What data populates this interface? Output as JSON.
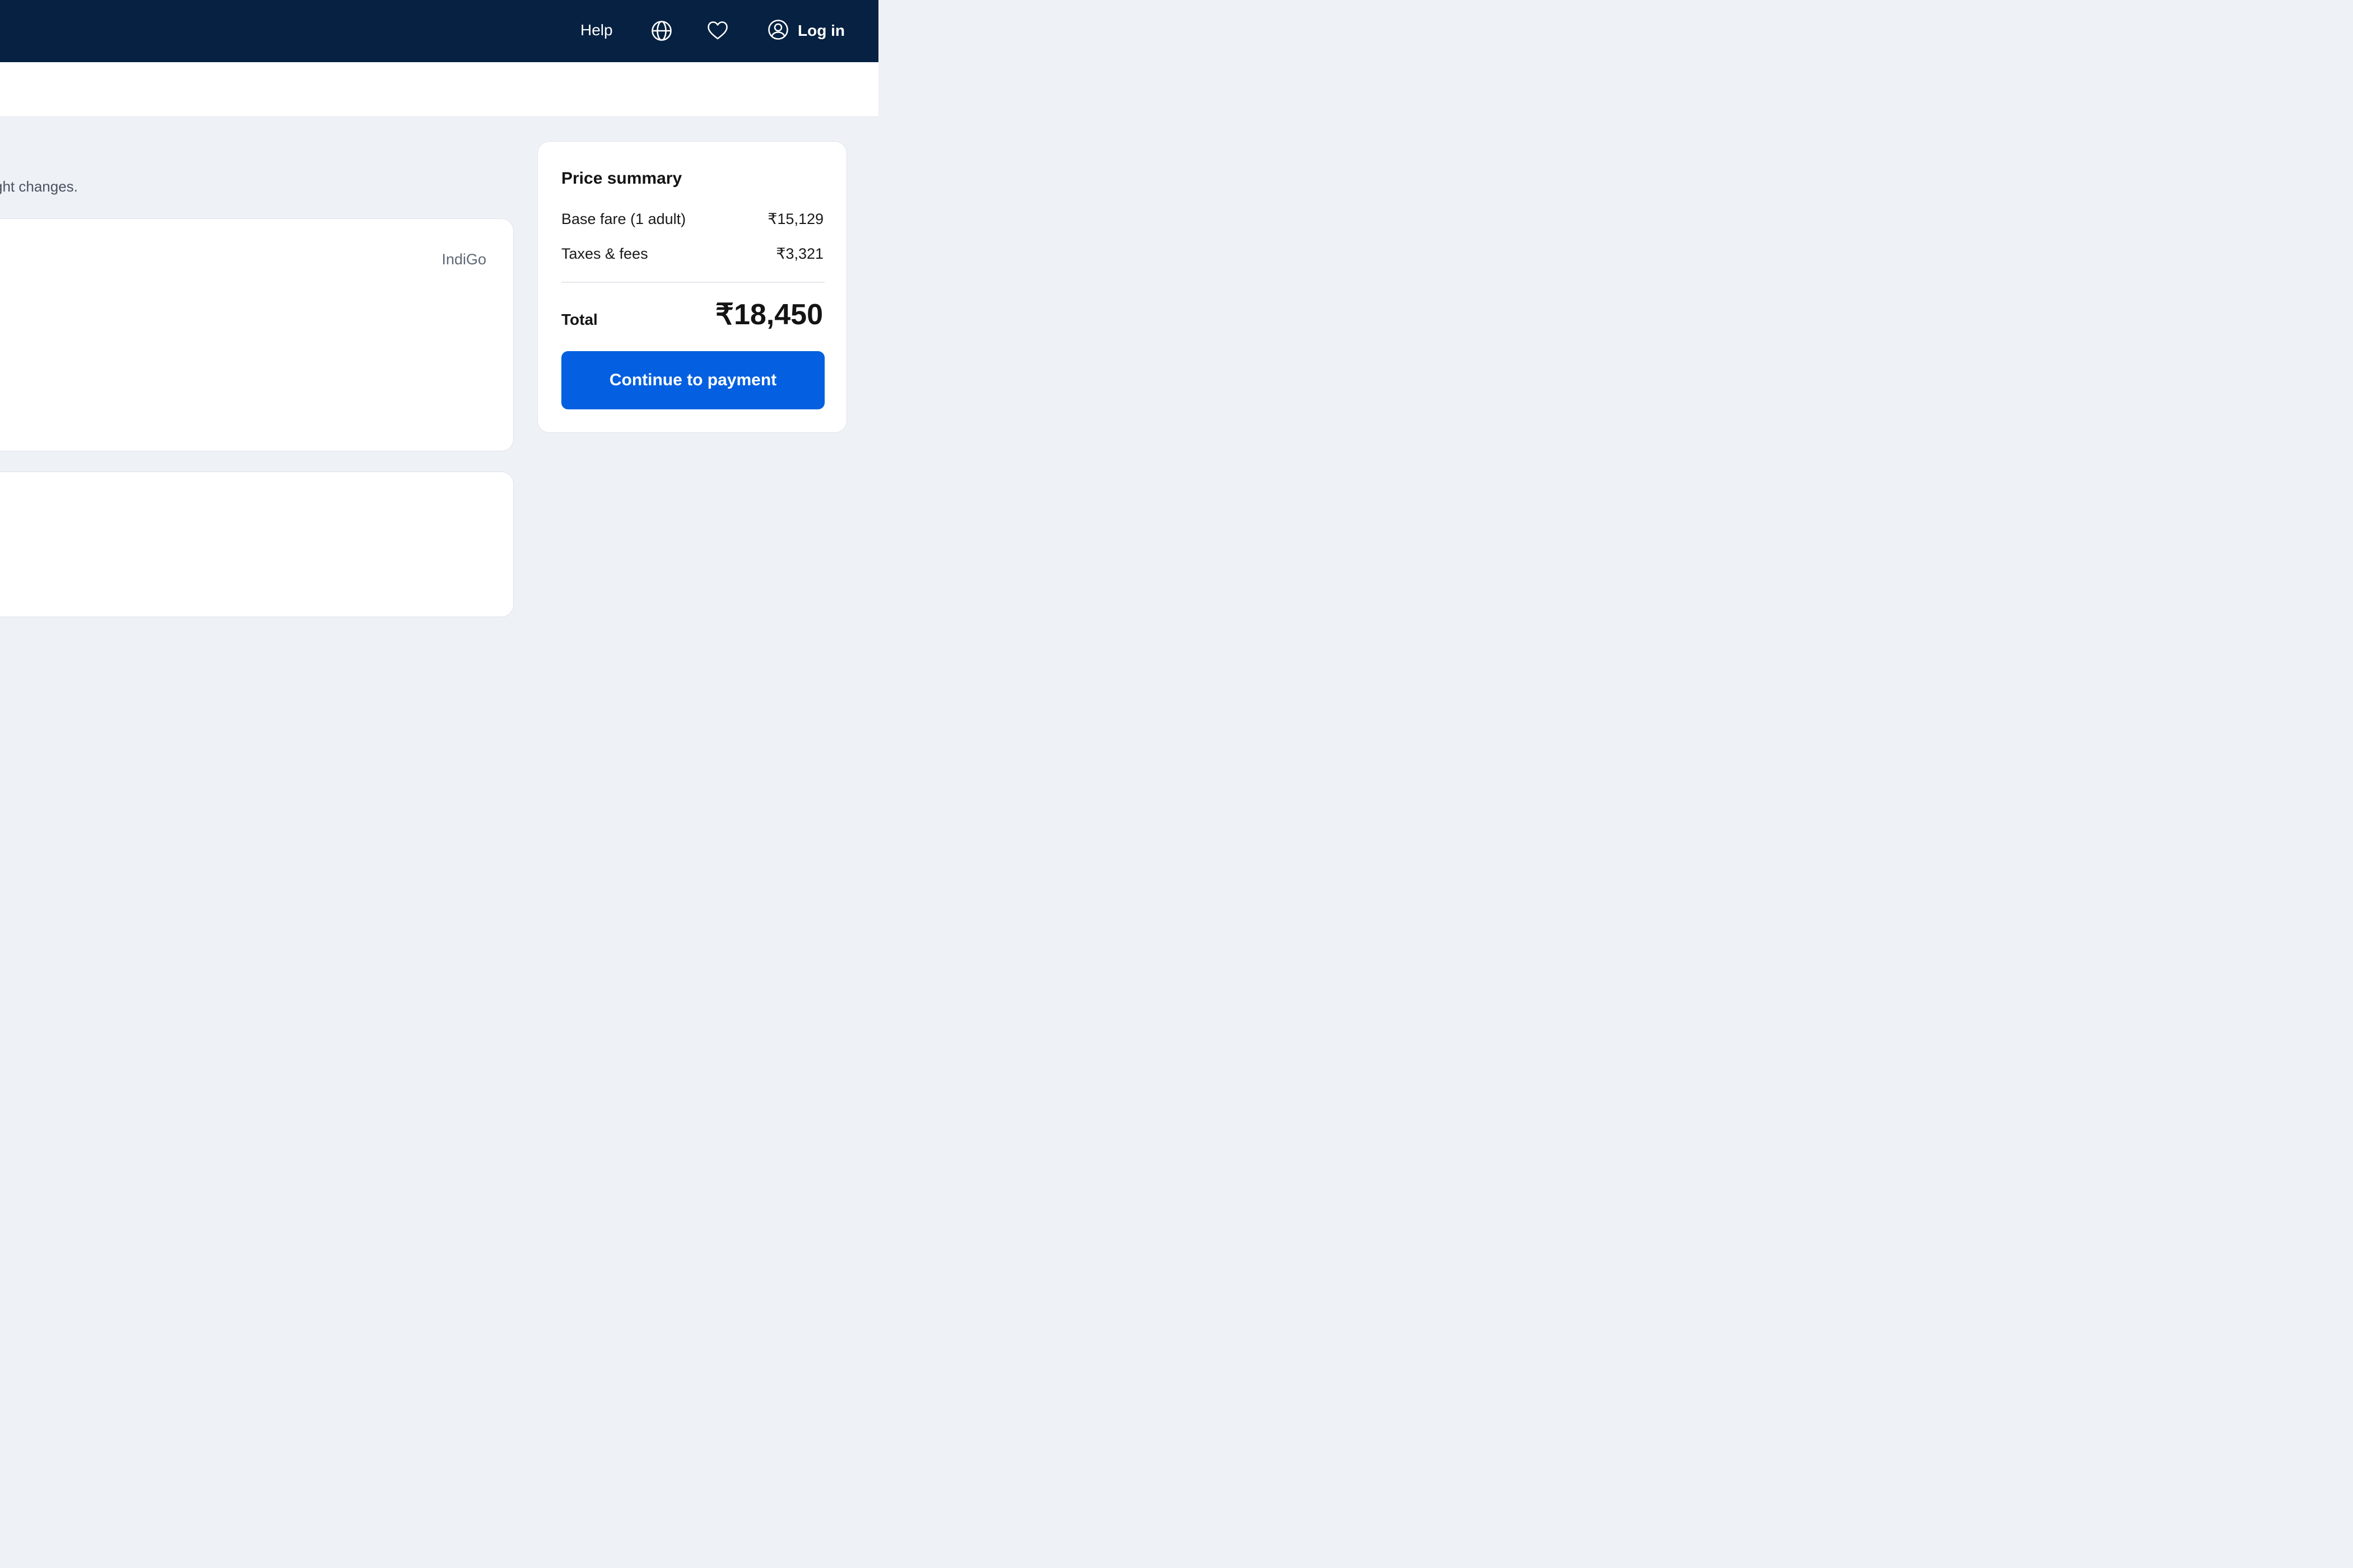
{
  "header": {
    "help_label": "Help",
    "login_label": "Log in",
    "icons": {
      "language": "globe-icon",
      "saved": "heart-icon",
      "account": "user-circle-icon"
    },
    "background_color": "#062141"
  },
  "notice": {
    "text": "ght changes."
  },
  "flight_card": {
    "airline": "IndiGo"
  },
  "price_summary": {
    "title": "Price summary",
    "rows": [
      {
        "label": "Base fare (1 adult)",
        "value": "₹15,129"
      },
      {
        "label": "Taxes & fees",
        "value": "₹3,321"
      }
    ],
    "total_label": "Total",
    "total_value": "₹18,450",
    "cta_label": "Continue to payment",
    "cta_color": "#0460e0"
  }
}
